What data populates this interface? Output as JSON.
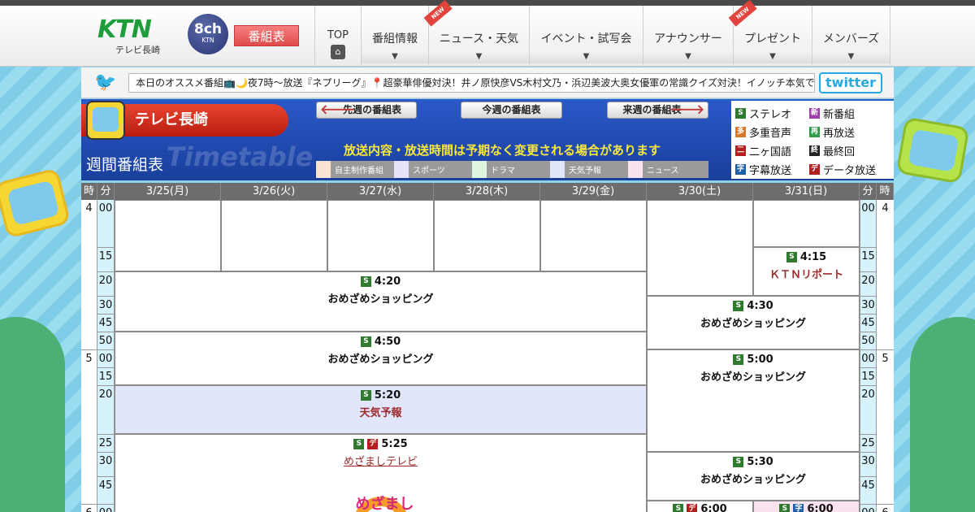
{
  "header": {
    "logo_text": "KTN",
    "logo_sub": "テレビ長崎",
    "channel_badge": "8ch",
    "channel_badge_sub": "KTN",
    "bangumi_button": "番組表",
    "nav": [
      {
        "label": "TOP",
        "new": false
      },
      {
        "label": "番組情報",
        "new": false
      },
      {
        "label": "ニュース・天気",
        "new": true
      },
      {
        "label": "イベント・試写会",
        "new": false
      },
      {
        "label": "アナウンサー",
        "new": false
      },
      {
        "label": "プレゼント",
        "new": true
      },
      {
        "label": "メンバーズ",
        "new": false
      }
    ],
    "new_badge": "NEW",
    "arrow_glyph": "▼"
  },
  "twitter": {
    "ticker": "本日のオススメ番組📺🌙夜7時～放送『ネプリーグ』📍超豪華俳優対決！井ノ原快彦VS木村文乃・浜辺美波大奥女優軍の常識クイズ対決！イノッチ本気でQ",
    "logo": "twitter"
  },
  "schedule_header": {
    "brand": "テレビ長崎",
    "title": "週間番組表",
    "watermark": "Timetable",
    "prev_week": "先週の番組表",
    "this_week": "今週の番組表",
    "next_week": "来週の番組表",
    "notice": "放送内容・放送時間は予期なく変更される場合があります",
    "genres": [
      {
        "label": "自主制作番組",
        "color": "#fde3d3"
      },
      {
        "label": "スポーツ",
        "color": "#e6e3fb"
      },
      {
        "label": "ドラマ",
        "color": "#dff5df"
      },
      {
        "label": "天気予報",
        "color": "#e2e6fb"
      },
      {
        "label": "ニュース",
        "color": "#fbe2ef"
      }
    ],
    "symbols": [
      {
        "icon": "S",
        "color": "#2f7a2f",
        "label": "ステレオ"
      },
      {
        "icon": "新",
        "color": "#9c3fa8",
        "label": "新番組"
      },
      {
        "icon": "多",
        "color": "#d6792a",
        "label": "多重音声"
      },
      {
        "icon": "再",
        "color": "#2f9a4a",
        "label": "再放送"
      },
      {
        "icon": "二",
        "color": "#b21f1f",
        "label": "二ヶ国語"
      },
      {
        "icon": "終",
        "color": "#222222",
        "label": "最終回"
      },
      {
        "icon": "字",
        "color": "#1f5fa8",
        "label": "字幕放送"
      },
      {
        "icon": "デ",
        "color": "#b21f1f",
        "label": "データ放送"
      }
    ]
  },
  "table": {
    "hour_label": "時",
    "minute_label": "分",
    "days": [
      "3/25(月)",
      "3/26(火)",
      "3/27(水)",
      "3/28(木)",
      "3/29(金)",
      "3/30(土)",
      "3/31(日)"
    ],
    "hours": [
      "4",
      "5",
      "6"
    ],
    "minutes": [
      "00",
      "15",
      "20",
      "30",
      "45",
      "50",
      "00",
      "15",
      "20",
      "25",
      "30",
      "45",
      "00"
    ],
    "programs": [
      {
        "time": "4:15",
        "title": "ＫＴＮリポート",
        "icons": [
          "S"
        ]
      },
      {
        "time": "4:20",
        "title": "おめざめショッピング",
        "icons": [
          "S"
        ]
      },
      {
        "time": "4:30",
        "title": "おめざめショッピング",
        "icons": [
          "S"
        ]
      },
      {
        "time": "4:50",
        "title": "おめざめショッピング",
        "icons": [
          "S"
        ]
      },
      {
        "time": "5:00",
        "title": "おめざめショッピング",
        "icons": [
          "S"
        ]
      },
      {
        "time": "5:20",
        "title": "天気予報",
        "icons": [
          "S"
        ]
      },
      {
        "time": "5:25",
        "title": "めざましテレビ",
        "icons": [
          "S",
          "デ"
        ],
        "logo_text": "めざまし"
      },
      {
        "time": "5:30",
        "title": "おめざめショッピング",
        "icons": [
          "S"
        ]
      },
      {
        "time": "6:00",
        "title": "",
        "icons": [
          "S",
          "デ"
        ]
      },
      {
        "time": "6:00",
        "title": "",
        "icons": [
          "S",
          "字"
        ]
      }
    ]
  }
}
